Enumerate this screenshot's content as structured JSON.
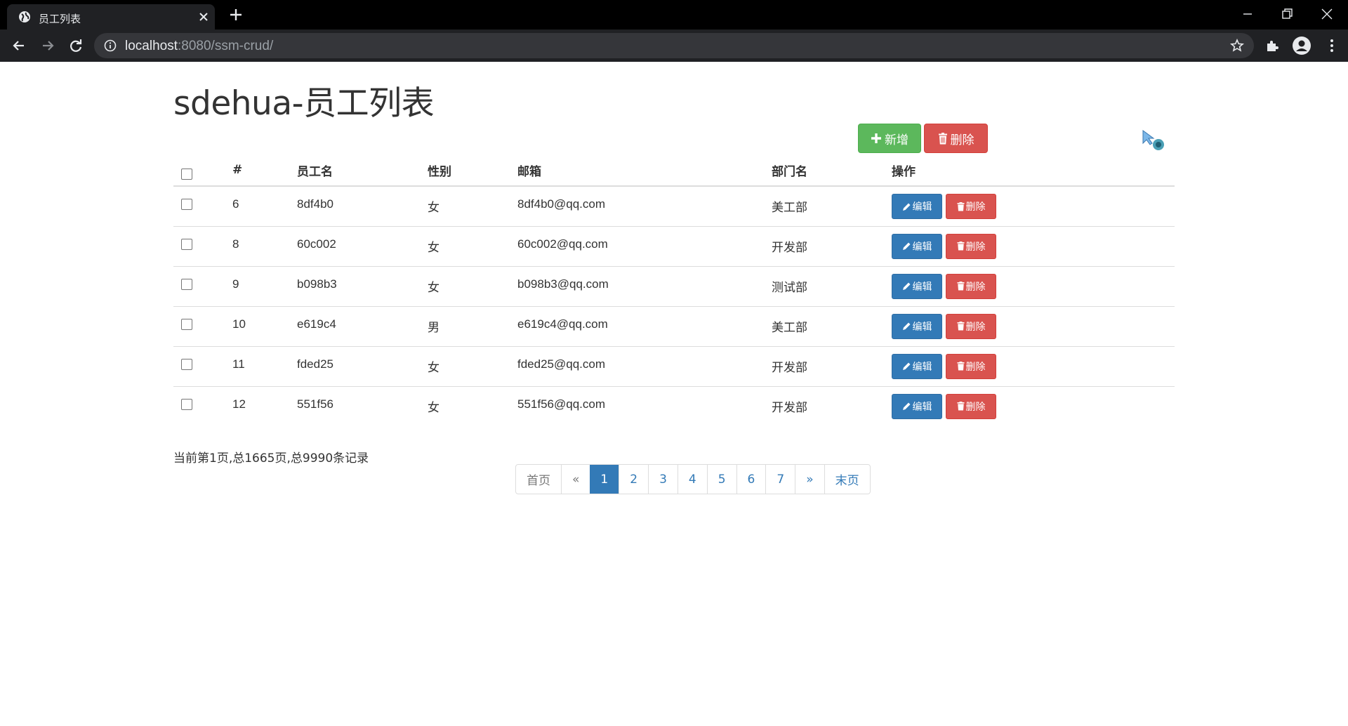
{
  "browser": {
    "tab_title": "员工列表",
    "url_host": "localhost",
    "url_rest": ":8080/ssm-crud/"
  },
  "page": {
    "title": "sdehua-员工列表",
    "add_button": "新增",
    "delete_all_button": "删除"
  },
  "table": {
    "headers": [
      "#",
      "员工名",
      "性别",
      "邮箱",
      "部门名",
      "操作"
    ],
    "edit_label": "编辑",
    "delete_label": "删除",
    "rows": [
      {
        "id": "6",
        "name": "8df4b0",
        "gender": "女",
        "email": "8df4b0@qq.com",
        "dept": "美工部"
      },
      {
        "id": "8",
        "name": "60c002",
        "gender": "女",
        "email": "60c002@qq.com",
        "dept": "开发部"
      },
      {
        "id": "9",
        "name": "b098b3",
        "gender": "女",
        "email": "b098b3@qq.com",
        "dept": "测试部"
      },
      {
        "id": "10",
        "name": "e619c4",
        "gender": "男",
        "email": "e619c4@qq.com",
        "dept": "美工部"
      },
      {
        "id": "11",
        "name": "fded25",
        "gender": "女",
        "email": "fded25@qq.com",
        "dept": "开发部"
      },
      {
        "id": "12",
        "name": "551f56",
        "gender": "女",
        "email": "551f56@qq.com",
        "dept": "开发部"
      }
    ]
  },
  "pagination": {
    "info": "当前第1页,总1665页,总9990条记录",
    "first": "首页",
    "prev": "«",
    "pages": [
      "1",
      "2",
      "3",
      "4",
      "5",
      "6",
      "7"
    ],
    "active_page": "1",
    "next": "»",
    "last": "末页"
  },
  "colors": {
    "success": "#5cb85c",
    "danger": "#d9534f",
    "primary": "#337ab7"
  }
}
